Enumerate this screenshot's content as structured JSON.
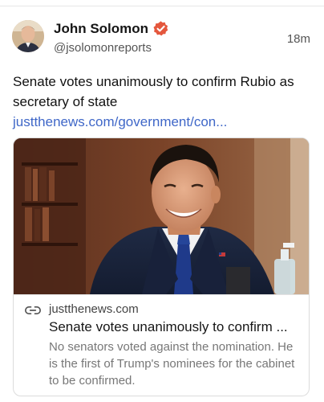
{
  "post": {
    "author": {
      "name": "John Solomon",
      "handle": "@jsolomonreports",
      "verified": true,
      "verified_color": "#e4573d",
      "avatar_icon": "avatar-photo"
    },
    "timestamp": "18m",
    "text": "Senate votes unanimously to confirm Rubio as secretary of state",
    "link_text": "justthenews.com/government/con...",
    "link_color": "#3f67c8",
    "link_card": {
      "image_alt": "Marco Rubio smiling at hearing",
      "link_icon": "link-icon",
      "domain": "justthenews.com",
      "title": "Senate votes unanimously to confirm ...",
      "description": "No senators voted against the nomination. He is the first of Trump's nominees for the cabinet to be confirmed."
    }
  }
}
